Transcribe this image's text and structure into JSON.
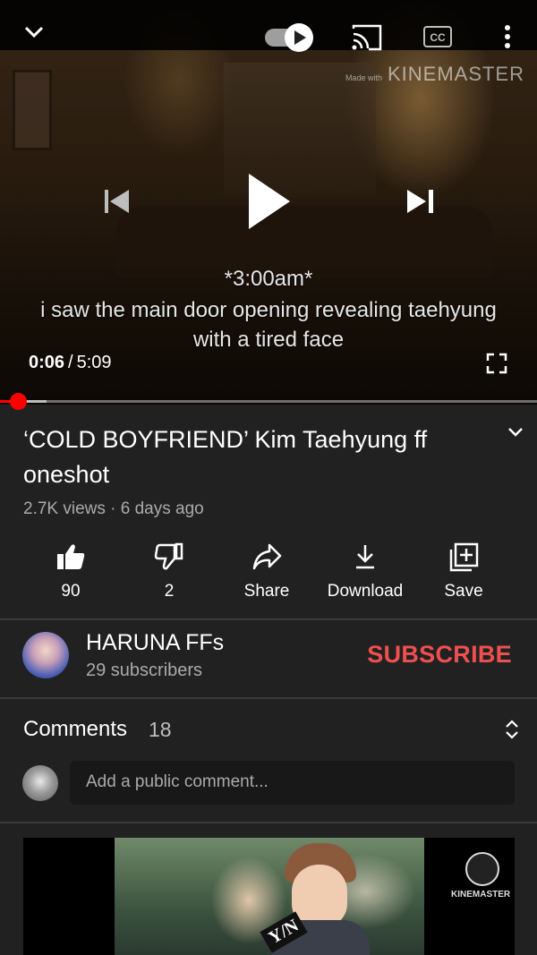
{
  "player": {
    "watermark_small": "Made with",
    "watermark_big": "KINEMASTER",
    "subtitle_lines": [
      "*3:00am*",
      "i saw the main door opening revealing taehyung",
      "with a tired face"
    ],
    "current_time": "0:06",
    "separator": "/",
    "duration": "5:09",
    "progress_fraction": 0.019,
    "buffered_fraction": 0.086,
    "autoplay_on": true
  },
  "video": {
    "title": "‘COLD BOYFRIEND’ Kim Taehyung ff oneshot",
    "meta": "2.7K views · 6 days ago"
  },
  "actions": [
    {
      "icon": "thumbs-up-icon",
      "label": "90"
    },
    {
      "icon": "thumbs-down-icon",
      "label": "2"
    },
    {
      "icon": "share-icon",
      "label": "Share"
    },
    {
      "icon": "download-icon",
      "label": "Download"
    },
    {
      "icon": "save-playlist-icon",
      "label": "Save"
    }
  ],
  "channel": {
    "name": "HARUNA FFs",
    "subscribers": "29 subscribers",
    "subscribe_label": "SUBSCRIBE",
    "subscribe_color": "#ef4f4f"
  },
  "comments": {
    "label": "Comments",
    "count": "18",
    "placeholder": "Add a public comment..."
  },
  "next_thumbnail": {
    "overlay_text": "Y/N",
    "logo_text": "KINEMASTER"
  }
}
